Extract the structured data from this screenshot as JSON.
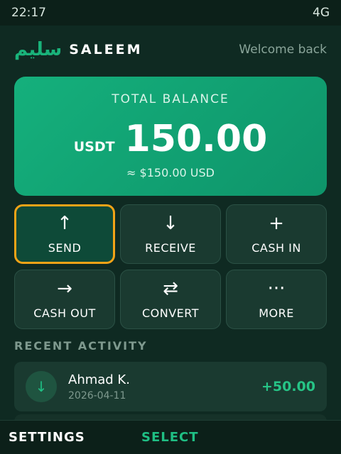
{
  "status_bar": {
    "time": "22:17",
    "network": "4G"
  },
  "header": {
    "brand_arabic": "سليم",
    "brand_name": "SALEEM",
    "welcome": "Welcome back"
  },
  "balance": {
    "label": "TOTAL BALANCE",
    "currency": "USDT",
    "amount": "150.00",
    "usd_equivalent": "≈ $150.00 USD"
  },
  "actions": [
    {
      "label": "SEND",
      "icon": "arrow-up-icon",
      "glyph": "↑",
      "selected": true
    },
    {
      "label": "RECEIVE",
      "icon": "arrow-down-icon",
      "glyph": "↓",
      "selected": false
    },
    {
      "label": "CASH IN",
      "icon": "plus-icon",
      "glyph": "+",
      "selected": false
    },
    {
      "label": "CASH OUT",
      "icon": "arrow-right-icon",
      "glyph": "→",
      "selected": false
    },
    {
      "label": "CONVERT",
      "icon": "swap-icon",
      "glyph": "⇄",
      "selected": false
    },
    {
      "label": "MORE",
      "icon": "more-icon",
      "glyph": "···",
      "selected": false
    }
  ],
  "recent_activity": {
    "title": "RECENT ACTIVITY",
    "items": [
      {
        "name": "Ahmad K.",
        "date": "2026-04-11",
        "amount": "+50.00",
        "icon": "arrow-down-icon",
        "glyph": "↓"
      }
    ]
  },
  "softkeys": {
    "left": "SETTINGS",
    "center": "SELECT"
  },
  "colors": {
    "background": "#0f2a22",
    "accent_green": "#15b07c",
    "focus_outline": "#f3a317",
    "positive_amount": "#26c486"
  }
}
